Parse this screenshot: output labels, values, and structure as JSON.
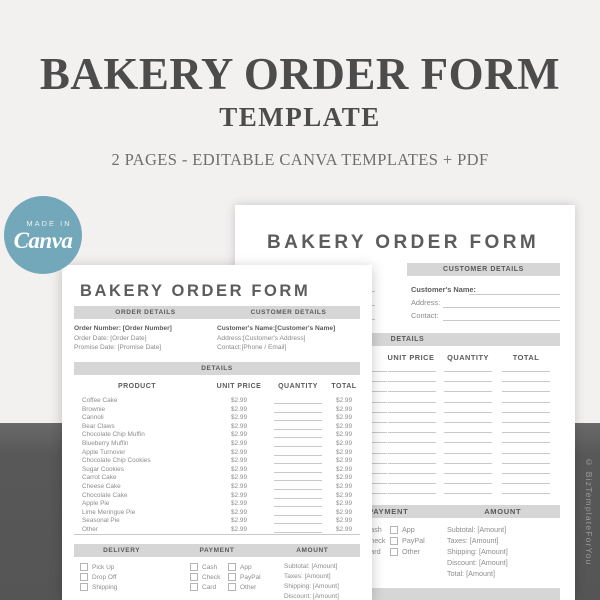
{
  "hero": {
    "title": "BAKERY ORDER FORM",
    "subtitle": "TEMPLATE",
    "note": "2 PAGES  - EDITABLE CANVA TEMPLATES + PDF"
  },
  "badge": {
    "made_in": "MADE IN",
    "brand": "Canva",
    "color": "#73a8bb"
  },
  "watermark": {
    "text": "© BizTemplateForYou",
    "color": "#9a9a9a"
  },
  "theme": {
    "page_background": "#f2f1f0",
    "band_color": "#5a5a5a",
    "section_header_bg": "#d6d6d6",
    "heading_text": "#5c5c5c",
    "body_text": "#8d8d8d",
    "rule_color": "#c9c9c9"
  },
  "front_page": {
    "title": "BAKERY ORDER FORM",
    "section_headers": {
      "order": "ORDER DETAILS",
      "customer": "CUSTOMER DETAILS",
      "details": "DETAILS"
    },
    "order_fields": [
      {
        "label": "Order Number:",
        "value": "[Order Number]",
        "bold": true
      },
      {
        "label": "Order Date:",
        "value": "[Order Date]",
        "bold": false
      },
      {
        "label": "Promise Date:",
        "value": "[Promise Date]",
        "bold": false
      }
    ],
    "customer_fields": [
      {
        "label": "Customer's Name:",
        "value": "[Customer's Name]",
        "bold": true
      },
      {
        "label": "Address:",
        "value": "[Customer's Address]",
        "bold": false
      },
      {
        "label": "Contact:",
        "value": "[Phone / Email]",
        "bold": false
      }
    ],
    "table_columns": [
      "PRODUCT",
      "UNIT PRICE",
      "QUANTITY",
      "TOTAL"
    ],
    "rows": [
      {
        "product": "Coffee Cake",
        "unit_price": "$2.99",
        "quantity": "",
        "total": "$2.99"
      },
      {
        "product": "Brownie",
        "unit_price": "$2.99",
        "quantity": "",
        "total": "$2.99"
      },
      {
        "product": "Cannoli",
        "unit_price": "$2.99",
        "quantity": "",
        "total": "$2.99"
      },
      {
        "product": "Bear Claws",
        "unit_price": "$2.99",
        "quantity": "",
        "total": "$2.99"
      },
      {
        "product": "Chocolate Chip Muffin",
        "unit_price": "$2.99",
        "quantity": "",
        "total": "$2.99"
      },
      {
        "product": "Blueberry Muffin",
        "unit_price": "$2.99",
        "quantity": "",
        "total": "$2.99"
      },
      {
        "product": "Apple Turnover",
        "unit_price": "$2.99",
        "quantity": "",
        "total": "$2.99"
      },
      {
        "product": "Chocolate Chip Cookies",
        "unit_price": "$2.99",
        "quantity": "",
        "total": "$2.99"
      },
      {
        "product": "Sugar Cookies",
        "unit_price": "$2.99",
        "quantity": "",
        "total": "$2.99"
      },
      {
        "product": "Carrot Cake",
        "unit_price": "$2.99",
        "quantity": "",
        "total": "$2.99"
      },
      {
        "product": "Cheese Cake",
        "unit_price": "$2.99",
        "quantity": "",
        "total": "$2.99"
      },
      {
        "product": "Chocolate Cake",
        "unit_price": "$2.99",
        "quantity": "",
        "total": "$2.99"
      },
      {
        "product": "Apple Pie",
        "unit_price": "$2.99",
        "quantity": "",
        "total": "$2.99"
      },
      {
        "product": "Lime Meringue Pie",
        "unit_price": "$2.99",
        "quantity": "",
        "total": "$2.99"
      },
      {
        "product": "Seasonal Pie",
        "unit_price": "$2.99",
        "quantity": "",
        "total": "$2.99"
      },
      {
        "product": "Other",
        "unit_price": "$2.99",
        "quantity": "",
        "total": "$2.99"
      }
    ],
    "footer_headers": {
      "delivery": "DELIVERY",
      "payment": "PAYMENT",
      "amount": "AMOUNT"
    },
    "delivery_options": [
      "Pick Up",
      "Drop Off",
      "Shipping"
    ],
    "payment_options_col1": [
      "Cash",
      "Check",
      "Card"
    ],
    "payment_options_col2": [
      "App",
      "PayPal",
      "Other"
    ],
    "amount_lines": [
      "Subtotal: [Amount]",
      "Taxes: [Amount]",
      "Shipping: [Amount]",
      "Discount: [Amount]"
    ]
  },
  "back_page": {
    "title": "BAKERY ORDER FORM",
    "section_headers": {
      "customer": "CUSTOMER DETAILS",
      "details": "DETAILS"
    },
    "customer_fields": [
      {
        "label": "Customer's Name:",
        "bold": true
      },
      {
        "label": "Address:",
        "bold": false
      },
      {
        "label": "Contact:",
        "bold": false
      }
    ],
    "table_columns": [
      "UNIT PRICE",
      "QUANTITY",
      "TOTAL"
    ],
    "blank_row_count": 13,
    "footer_headers": {
      "payment": "PAYMENT",
      "amount": "AMOUNT"
    },
    "payment_options_col1": [
      "Cash",
      "Check",
      "Card"
    ],
    "payment_options_col2": [
      "App",
      "PayPal",
      "Other"
    ],
    "amount_lines": [
      "Subtotal: [Amount]",
      "Taxes: [Amount]",
      "Shipping: [Amount]",
      "Discount: [Amount]",
      "Total: [Amount]"
    ]
  }
}
